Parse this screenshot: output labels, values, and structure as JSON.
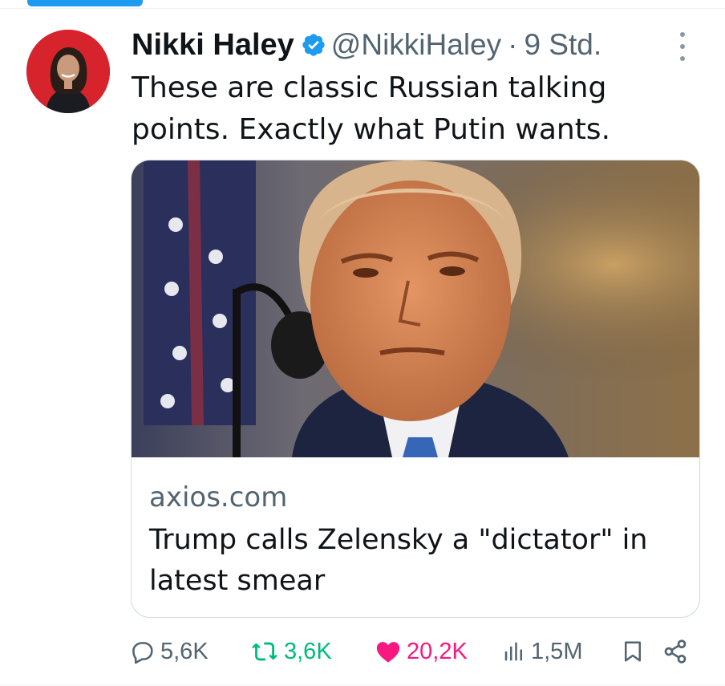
{
  "tweet": {
    "display_name": "Nikki Haley",
    "verified_icon": "verified-badge-icon",
    "handle": "@NikkiHaley",
    "separator": "·",
    "time": "9 Std.",
    "text": "These are classic Russian talking points. Exactly what Putin wants."
  },
  "card": {
    "image_description_icon": "news-photo",
    "domain": "axios.com",
    "title": "Trump calls Zelensky a \"dictator\" in latest smear"
  },
  "actions": {
    "replies": "5,6K",
    "reposts": "3,6K",
    "likes": "20,2K",
    "views": "1,5M",
    "bookmark_icon": "bookmark-icon",
    "share_icon": "share-icon"
  },
  "colors": {
    "accent": "#1d9bf0",
    "repost": "#00ba7c",
    "like": "#f91880",
    "muted": "#536471",
    "avatar_bg": "#d7232b"
  }
}
